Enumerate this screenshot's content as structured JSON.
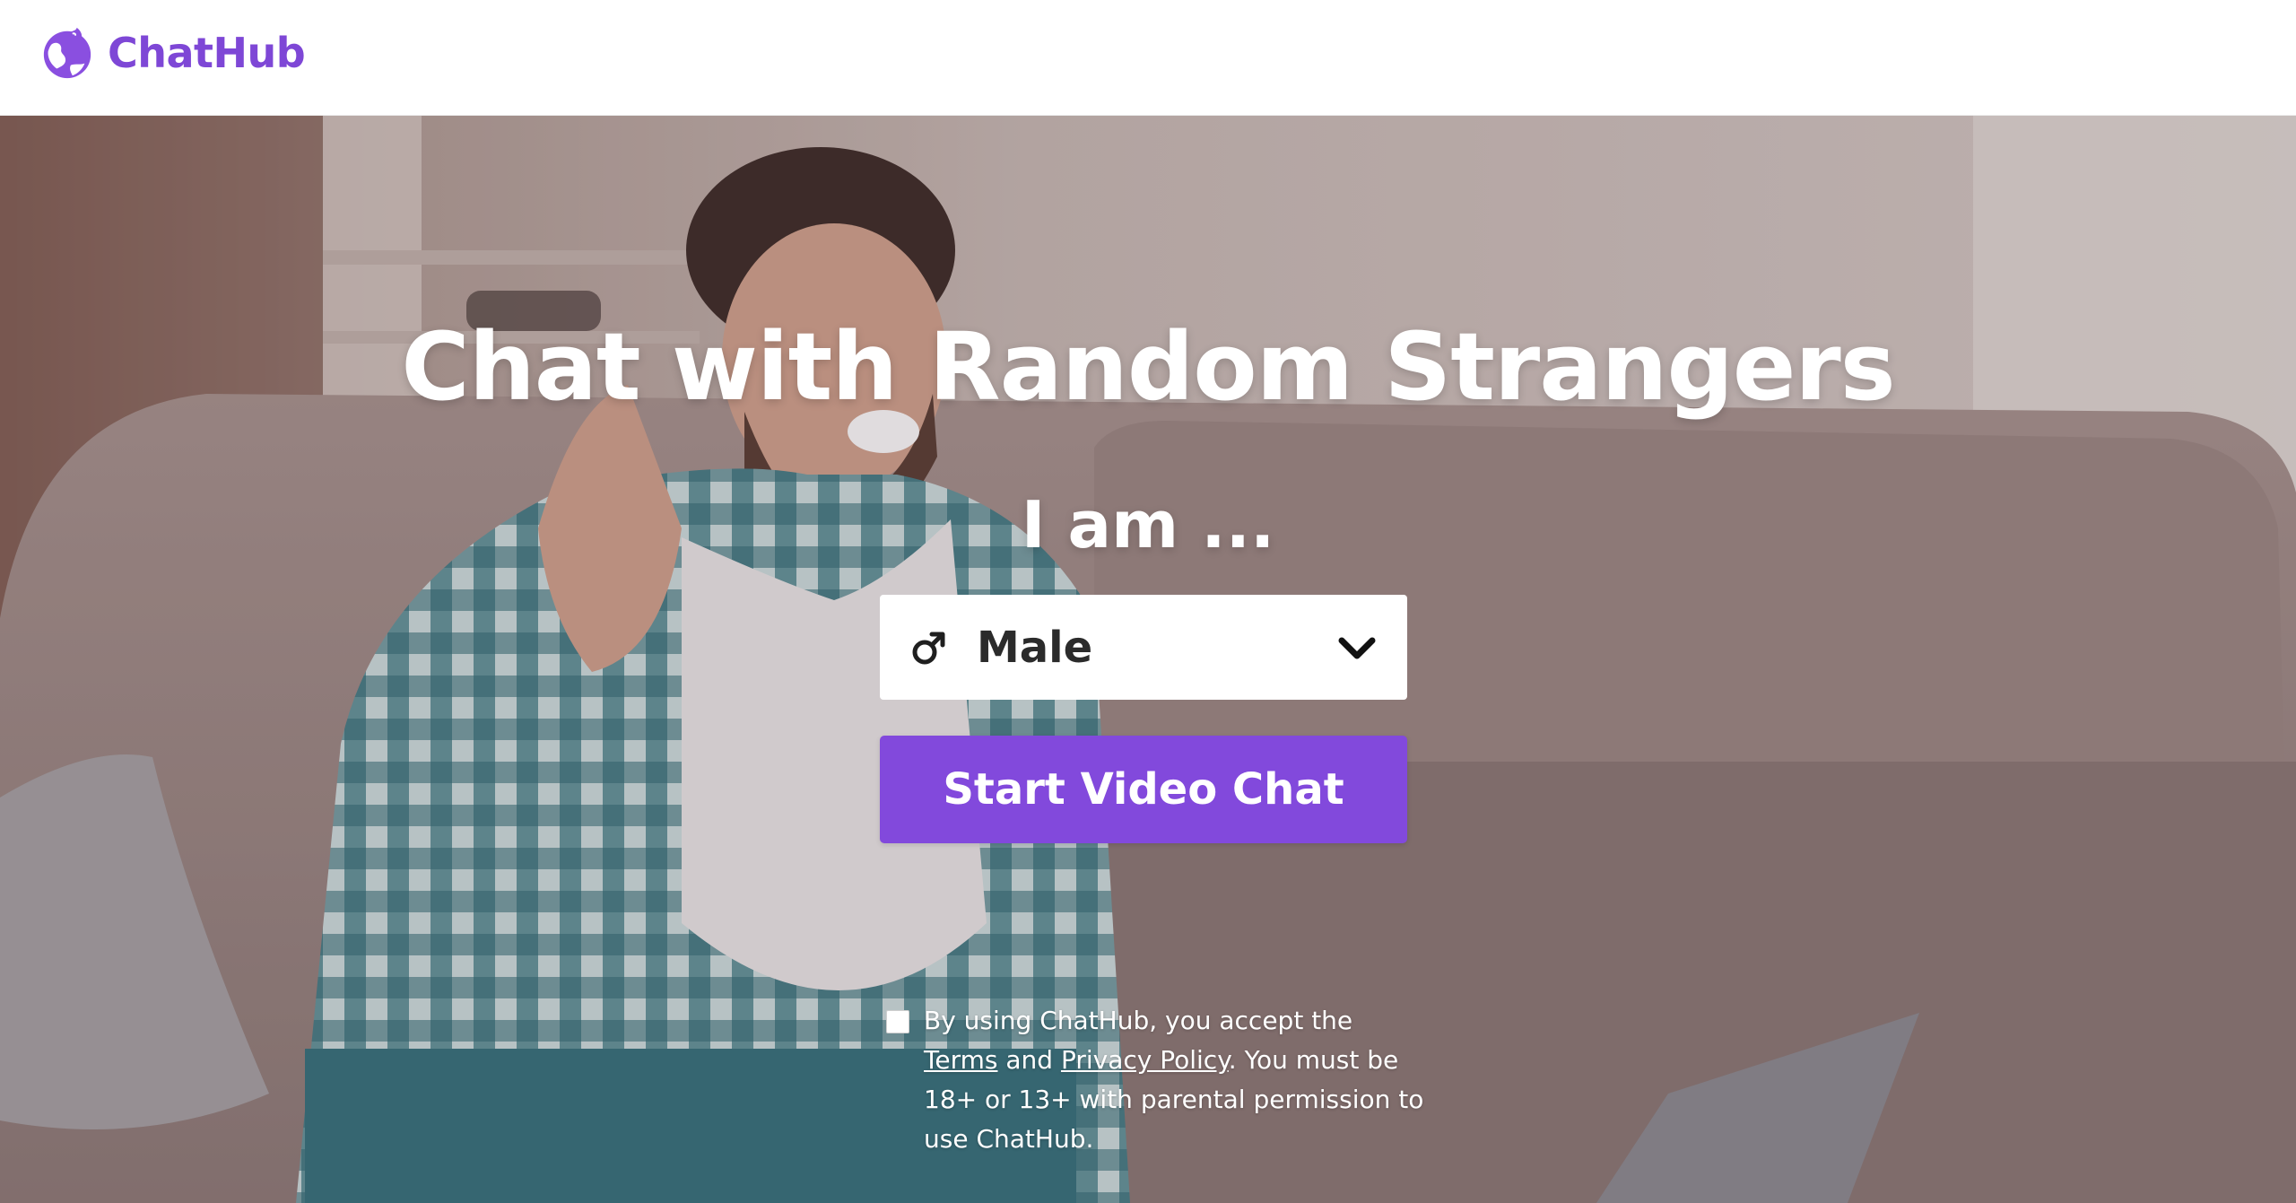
{
  "header": {
    "brand_name": "ChatHub",
    "logo_icon": "globe-icon",
    "brand_color": "#7e47d6"
  },
  "hero": {
    "title": "Chat with Random Strangers",
    "prompt": "I am ...",
    "gender_select": {
      "selected_value": "Male",
      "icon": "male-symbol-icon",
      "dropdown_icon": "chevron-down-icon"
    },
    "start_button_label": "Start Video Chat",
    "accent_color": "#8249dc",
    "background_image": "man-waving-on-sofa-with-laptop"
  },
  "consent": {
    "text_before": "By using ChatHub, you accept the ",
    "terms_label": "Terms",
    "text_and": " and ",
    "privacy_label": "Privacy Policy",
    "text_after": ". You must be 18+ or 13+ with parental permission to use ChatHub."
  }
}
